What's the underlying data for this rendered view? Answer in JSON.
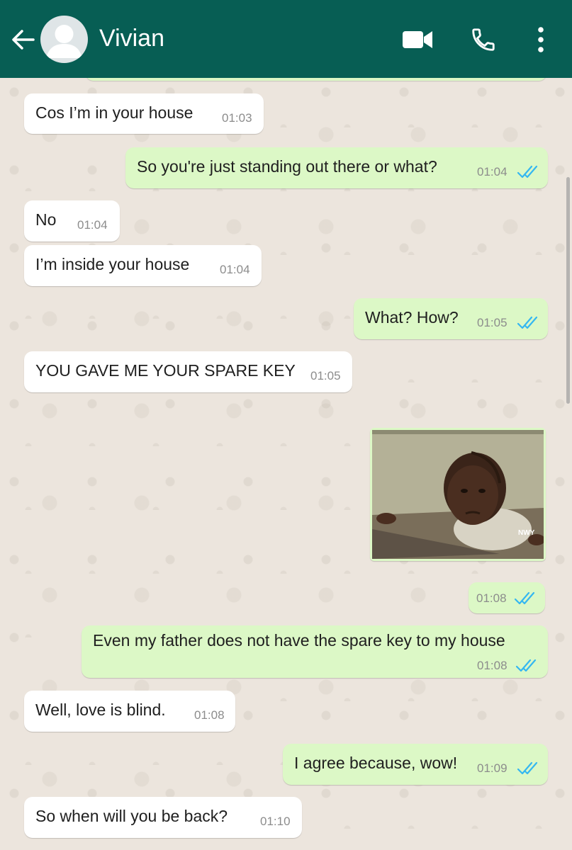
{
  "header": {
    "contact_name": "Vivian",
    "icons": [
      "back-arrow-icon",
      "avatar",
      "video-call-icon",
      "phone-icon",
      "more-options-icon"
    ],
    "color": "#075e54"
  },
  "colors": {
    "incoming_bubble": "#ffffff",
    "outgoing_bubble": "#dcf8c6",
    "read_ticks": "#34b7f1",
    "chat_background": "#ece5dd"
  },
  "messages": [
    {
      "direction": "in",
      "text": "Cos I’m in your house",
      "time": "01:03"
    },
    {
      "direction": "out",
      "text": "So you're just standing out there or what?",
      "time": "01:04",
      "status": "read"
    },
    {
      "direction": "in",
      "text": "No",
      "time": "01:04"
    },
    {
      "direction": "in",
      "text": "I’m inside your house",
      "time": "01:04"
    },
    {
      "direction": "out",
      "text": "What? How?",
      "time": "01:05",
      "status": "read"
    },
    {
      "direction": "in",
      "text": "YOU GAVE ME YOUR SPARE KEY",
      "time": "01:05"
    },
    {
      "direction": "out",
      "type": "image",
      "image_description": "confused boy meme",
      "watermark": "NWY",
      "time": "01:08",
      "status": "read"
    },
    {
      "direction": "out",
      "text": "Even my father does not have the spare key to my house",
      "time": "01:08",
      "status": "read"
    },
    {
      "direction": "in",
      "text": "Well, love is blind.",
      "time": "01:08"
    },
    {
      "direction": "out",
      "text": "I agree because, wow!",
      "time": "01:09",
      "status": "read"
    },
    {
      "direction": "in",
      "text": "So when will you be back?",
      "time": "01:10"
    }
  ]
}
